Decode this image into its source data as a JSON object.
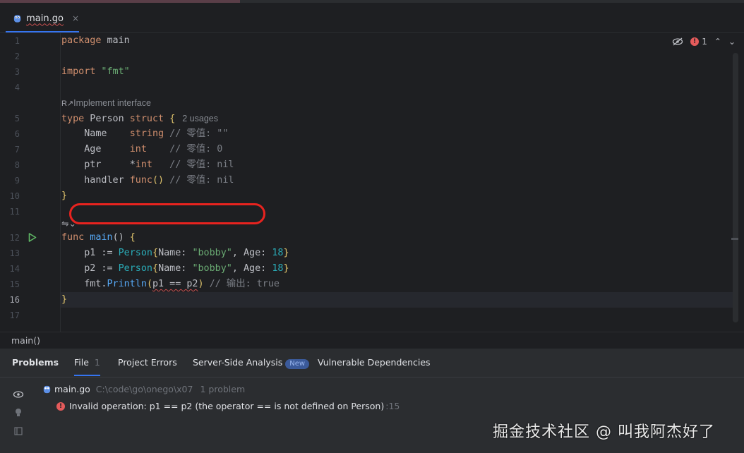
{
  "tab": {
    "filename": "main.go",
    "close": "×"
  },
  "editor": {
    "line_numbers": [
      "1",
      "2",
      "3",
      "4",
      "5",
      "6",
      "7",
      "8",
      "9",
      "10",
      "11",
      "12",
      "13",
      "14",
      "15",
      "16",
      "17"
    ],
    "error_count": "1",
    "hint_implement": "Implement interface",
    "usages": "2 usages",
    "code": {
      "l1_kw": "package",
      "l1_rest": " main",
      "l3_kw": "import",
      "l3_str": " \"fmt\"",
      "l5_kw1": "type",
      "l5_name": " Person ",
      "l5_kw2": "struct",
      "l5_br": " {",
      "l6_field": "    Name    ",
      "l6_type": "string",
      "l6_cm": " // 零值: \"\"",
      "l7_field": "    Age     ",
      "l7_type": "int",
      "l7_cm": "    // 零值: 0",
      "l8_field": "    ptr     ",
      "l8_star": "*",
      "l8_type": "int",
      "l8_cm": "   // 零值: nil",
      "l9_field": "    handler ",
      "l9_type": "func",
      "l9_paren": "()",
      "l9_cm": " // 零值: nil",
      "l10_br": "}",
      "l12_kw": "func",
      "l12_fn": " main",
      "l12_paren": "() ",
      "l12_br": "{",
      "l13_a": "    p1 := ",
      "l13_t": "Person",
      "l13_b": "{",
      "l13_c": "Name: ",
      "l13_s": "\"bobby\"",
      "l13_d": ", Age: ",
      "l13_n": "18",
      "l13_e": "}",
      "l14_a": "    p2 := ",
      "l14_t": "Person",
      "l14_b": "{",
      "l14_c": "Name: ",
      "l14_s": "\"bobby\"",
      "l14_d": ", Age: ",
      "l14_n": "18",
      "l14_e": "}",
      "l15_a": "    fmt.",
      "l15_fn": "Println",
      "l15_b": "(",
      "l15_c": "p1 == p2",
      "l15_d": ")",
      "l15_cm": " // 输出: true",
      "l16_br": "}"
    }
  },
  "breadcrumb": "main()",
  "problems": {
    "title": "Problems",
    "tabs": [
      {
        "label": "File",
        "count": "1"
      },
      {
        "label": "Project Errors"
      },
      {
        "label": "Server-Side Analysis",
        "badge": "New"
      },
      {
        "label": "Vulnerable Dependencies"
      }
    ],
    "file": {
      "name": "main.go",
      "path": "C:\\code\\go\\onego\\x07",
      "count": "1 problem"
    },
    "error": {
      "message": "Invalid operation: p1 == p2 (the operator == is not defined on Person)",
      "location": ":15"
    }
  },
  "watermark": "掘金技术社区 @ 叫我阿杰好了",
  "colors": {
    "accent": "#3574f0",
    "error": "#e55b5b",
    "highlight_oval": "#e8231f"
  }
}
